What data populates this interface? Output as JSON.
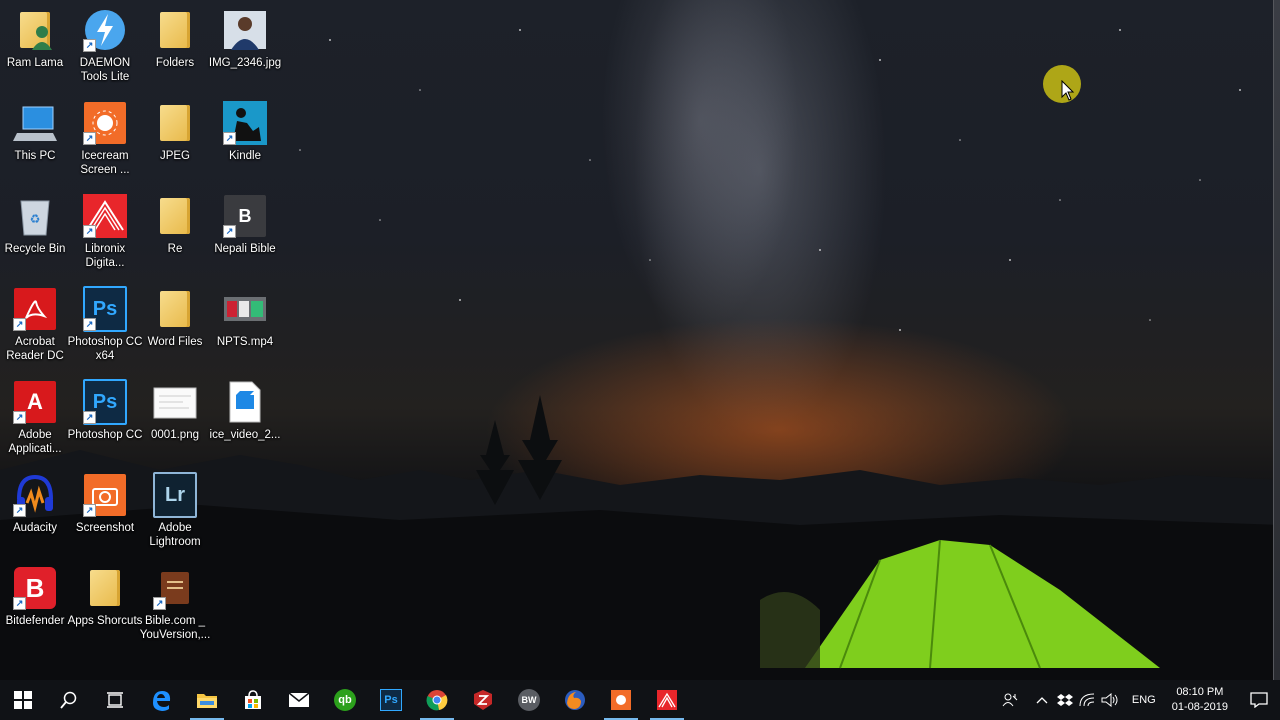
{
  "desktop": {
    "icons": [
      {
        "label": "Ram Lama",
        "icon": "user-folder-icon"
      },
      {
        "label": "DAEMON Tools Lite",
        "icon": "daemon-tools-icon"
      },
      {
        "label": "Folders",
        "icon": "folder-icon"
      },
      {
        "label": "IMG_2346.jpg",
        "icon": "photo-thumbnail-icon"
      },
      {
        "label": "This PC",
        "icon": "computer-icon"
      },
      {
        "label": "Icecream Screen ...",
        "icon": "icecream-icon"
      },
      {
        "label": "JPEG",
        "icon": "folder-icon"
      },
      {
        "label": "Kindle",
        "icon": "kindle-icon"
      },
      {
        "label": "Recycle Bin",
        "icon": "recycle-bin-icon"
      },
      {
        "label": "Libronix Digita...",
        "icon": "libronix-icon"
      },
      {
        "label": "Re",
        "icon": "folder-icon"
      },
      {
        "label": "Nepali Bible",
        "icon": "bible-app-icon"
      },
      {
        "label": "Acrobat Reader DC",
        "icon": "acrobat-icon"
      },
      {
        "label": "Photoshop CC x64",
        "icon": "photoshop-icon"
      },
      {
        "label": "Word Files",
        "icon": "folder-icon"
      },
      {
        "label": "NPTS.mp4",
        "icon": "video-thumbnail-icon"
      },
      {
        "label": "Adobe Applicati...",
        "icon": "adobe-icon"
      },
      {
        "label": "Photoshop CC",
        "icon": "photoshop-icon"
      },
      {
        "label": "0001.png",
        "icon": "image-file-icon"
      },
      {
        "label": "ice_video_2...",
        "icon": "video-file-icon"
      },
      {
        "label": "Audacity",
        "icon": "audacity-icon"
      },
      {
        "label": "Screenshot",
        "icon": "screenshot-icon"
      },
      {
        "label": "Adobe Lightroom",
        "icon": "lightroom-icon"
      },
      {
        "label": "Bitdefender",
        "icon": "bitdefender-icon"
      },
      {
        "label": "Apps Shorcuts",
        "icon": "folder-icon"
      },
      {
        "label": "Bible.com _ YouVersion,...",
        "icon": "bible-icon"
      }
    ]
  },
  "taskbar": {
    "buttons": [
      {
        "name": "start-button",
        "icon": "windows-icon"
      },
      {
        "name": "search-button",
        "icon": "search-icon"
      },
      {
        "name": "task-view-button",
        "icon": "task-view-icon"
      },
      {
        "name": "edge-button",
        "icon": "edge-icon"
      },
      {
        "name": "file-explorer-button",
        "icon": "folder-icon"
      },
      {
        "name": "store-button",
        "icon": "store-icon"
      },
      {
        "name": "mail-button",
        "icon": "mail-icon"
      },
      {
        "name": "quickbooks-button",
        "icon": "qb-icon",
        "text": "qb"
      },
      {
        "name": "photoshop-button",
        "icon": "photoshop-icon",
        "text": "Ps"
      },
      {
        "name": "chrome-button",
        "icon": "chrome-icon"
      },
      {
        "name": "red-app-button",
        "icon": "red-app-icon"
      },
      {
        "name": "bw-button",
        "icon": "bw-icon",
        "text": "BW"
      },
      {
        "name": "firefox-button",
        "icon": "firefox-icon"
      },
      {
        "name": "icecream-button",
        "icon": "icecream-icon"
      },
      {
        "name": "libronix-button",
        "icon": "libronix-icon"
      }
    ],
    "tray": {
      "language": "ENG",
      "time": "08:10 PM",
      "date": "01-08-2019"
    }
  }
}
